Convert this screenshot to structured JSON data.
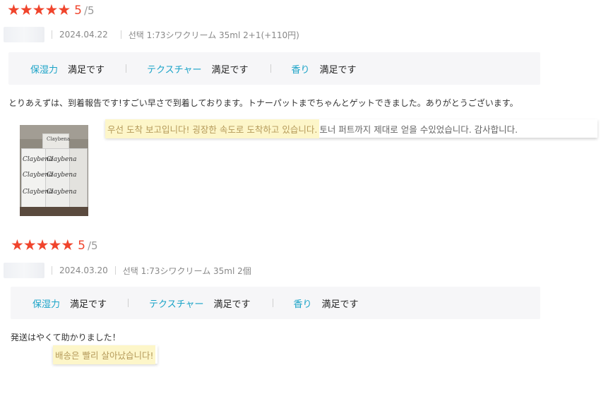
{
  "reviews": [
    {
      "rating": "5",
      "rating_max": "/5",
      "date": "2024.04.22",
      "option": "선택 1:73シワクリーム 35ml 2+1(+110円)",
      "attributes": [
        {
          "name": "保湿力",
          "value": "満足です"
        },
        {
          "name": "テクスチャー",
          "value": "満足です"
        },
        {
          "name": "香り",
          "value": "満足です"
        }
      ],
      "text": "とりあえずは、到着報告です!すごい早さで到着しております。トナーパットまでちゃんとゲットできました。ありがとうございます。",
      "translation_highlight": "우선 도착 보고입니다! 굉장한 속도로 도착하고 있습니다.",
      "translation_rest": " 토너 퍼트까지 제대로 얻을 수있었습니다. 감사합니다.",
      "photo_brand": "Claybena"
    },
    {
      "rating": "5",
      "rating_max": "/5",
      "date": "2024.03.20",
      "option": "선택 1:73シワクリーム 35ml 2個",
      "attributes": [
        {
          "name": "保湿力",
          "value": "満足です"
        },
        {
          "name": "テクスチャー",
          "value": "満足です"
        },
        {
          "name": "香り",
          "value": "満足です"
        }
      ],
      "text": "発送はやくて助かりました！",
      "translation_highlight": "배송은 빨리 살아났습니다!"
    }
  ],
  "colors": {
    "accent": "#f0442c",
    "attr_label": "#1aa3c7",
    "highlight": "#fdf6c9"
  },
  "icons": {
    "star": "star-icon"
  }
}
